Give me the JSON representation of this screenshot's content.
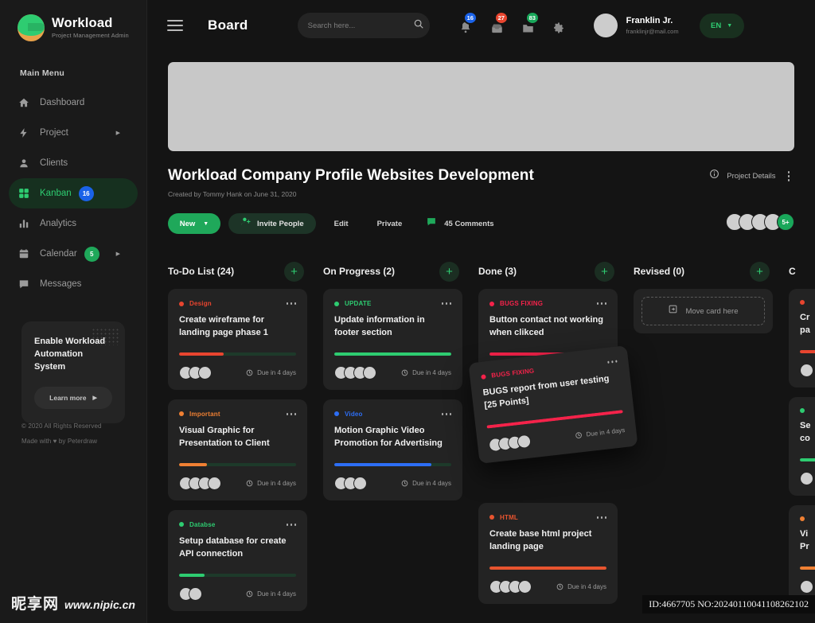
{
  "sidebar": {
    "brand": {
      "title": "Workload",
      "subtitle": "Project Management Admin"
    },
    "menu_label": "Main Menu",
    "items": [
      {
        "label": "Dashboard",
        "icon": "home-icon",
        "badge": null,
        "caret": false,
        "active": false
      },
      {
        "label": "Project",
        "icon": "bolt-icon",
        "badge": null,
        "caret": true,
        "active": false
      },
      {
        "label": "Clients",
        "icon": "user-icon",
        "badge": null,
        "caret": false,
        "active": false
      },
      {
        "label": "Kanban",
        "icon": "grid-icon",
        "badge": "16",
        "badge_color": "#1a62e8",
        "caret": false,
        "active": true
      },
      {
        "label": "Analytics",
        "icon": "bar-chart-icon",
        "badge": null,
        "caret": false,
        "active": false
      },
      {
        "label": "Calendar",
        "icon": "calendar-icon",
        "badge": "5",
        "badge_color": "#1fa85a",
        "caret": true,
        "active": false
      },
      {
        "label": "Messages",
        "icon": "chat-icon",
        "badge": null,
        "caret": false,
        "active": false
      }
    ],
    "promo": {
      "title": "Enable Workload Automation System",
      "button": "Learn more"
    },
    "footer": {
      "copyright": "© 2020 All Rights Reserved",
      "made_by": "Made with ♥ by Peterdraw"
    }
  },
  "topbar": {
    "page_title": "Board",
    "search": {
      "value": "",
      "placeholder": "Search here..."
    },
    "icons": [
      {
        "name": "bell-icon",
        "count": "16",
        "color": "#1a62e8"
      },
      {
        "name": "mail-icon",
        "count": "27",
        "color": "#e8452f"
      },
      {
        "name": "folder-icon",
        "count": "83",
        "color": "#19a75a"
      },
      {
        "name": "gear-icon",
        "count": null,
        "color": null
      }
    ],
    "profile": {
      "name": "Franklin Jr.",
      "email": "franklinjr@mail.com"
    },
    "language": "EN"
  },
  "project": {
    "title": "Workload  Company Profile Websites Development",
    "subtitle": "Created by Tommy Hank on June 31, 2020",
    "new_label": "New",
    "invite_label": "Invite People",
    "edit_label": "Edit",
    "private_label": "Private",
    "comments_label": "45 Comments",
    "details_label": "Project Details",
    "avatars_more": "5+"
  },
  "board": {
    "move_card_here": "Move card here",
    "columns": [
      {
        "title": "To-Do List (24)",
        "cards": [
          {
            "tag": "Design",
            "tag_color": "#e8452f",
            "title": "Create wireframe for landing page phase 1",
            "progress": 38,
            "progress_color": "#e8452f",
            "avatars": 3,
            "due": "Due in 4 days"
          },
          {
            "tag": "Important",
            "tag_color": "#f08033",
            "title": "Visual Graphic for Presentation to Client",
            "progress": 24,
            "progress_color": "#f08033",
            "avatars": 4,
            "due": "Due in 4 days"
          },
          {
            "tag": "Databse",
            "tag_color": "#2ecc71",
            "title": "Setup database for create API connection",
            "progress": 22,
            "progress_color": "#2ecc71",
            "avatars": 2,
            "due": "Due in 4 days"
          }
        ]
      },
      {
        "title": "On Progress (2)",
        "cards": [
          {
            "tag": "UPDATE",
            "tag_color": "#2ecc71",
            "title": "Update information in footer section",
            "progress": 100,
            "progress_color": "#2ecc71",
            "avatars": 4,
            "due": "Due in 4 days"
          },
          {
            "tag": "Video",
            "tag_color": "#2d6ef5",
            "title": "Motion Graphic Video Promotion for Advertising",
            "progress": 83,
            "progress_color": "#2d6ef5",
            "avatars": 3,
            "due": "Due in 4 days"
          }
        ]
      },
      {
        "title": "Done (3)",
        "cards": [
          {
            "tag": "BUGS FIXING",
            "tag_color": "#f5224a",
            "title": "Button contact not working when clikced",
            "progress": 100,
            "progress_color": "#f5224a",
            "avatars": 4,
            "due": "Due in 4 days"
          },
          {
            "tag": "HTML",
            "tag_color": "#e8542f",
            "title": "Create base html project landing page",
            "progress": 100,
            "progress_color": "#e8542f",
            "avatars": 4,
            "due": "Due in 4 days"
          }
        ],
        "dragging_card": {
          "tag": "BUGS FIXING",
          "tag_color": "#f5224a",
          "title": "BUGS report from user testing [25 Points]",
          "progress": 100,
          "progress_color": "#f5224a",
          "avatars": 4,
          "due": "Due in 4 days"
        }
      },
      {
        "title": "Revised (0)",
        "cards": [],
        "dropzone": true
      },
      {
        "title": "C",
        "cards": [
          {
            "tag": "",
            "tag_color": "#e8452f",
            "title": "Cr\npa",
            "progress": 38,
            "progress_color": "#e8452f",
            "avatars": 1,
            "due": ""
          },
          {
            "tag": "",
            "tag_color": "#2ecc71",
            "title": "Se\nco",
            "progress": 40,
            "progress_color": "#2ecc71",
            "avatars": 1,
            "due": ""
          },
          {
            "tag": "",
            "tag_color": "#f08033",
            "title": "Vi\nPr",
            "progress": 40,
            "progress_color": "#f08033",
            "avatars": 1,
            "due": ""
          }
        ]
      }
    ]
  },
  "watermark": {
    "cn": "昵享网",
    "url": "www.nipic.cn",
    "id": "ID:4667705 NO:20240110041108262102"
  }
}
